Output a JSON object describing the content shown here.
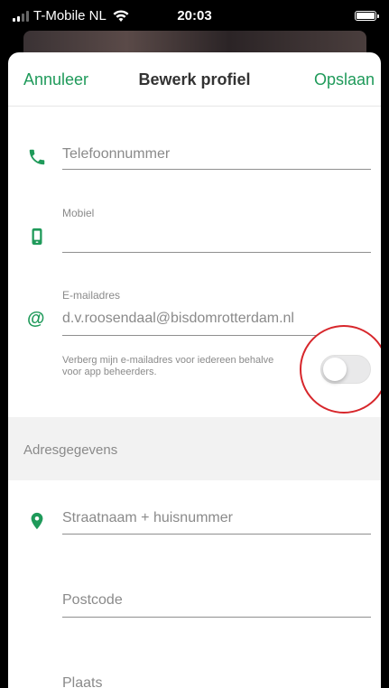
{
  "status_bar": {
    "carrier": "T-Mobile NL",
    "time": "20:03",
    "icons": [
      "signal-icon",
      "wifi-icon",
      "battery-icon"
    ]
  },
  "nav": {
    "cancel_label": "Annuleer",
    "title": "Bewerk profiel",
    "save_label": "Opslaan"
  },
  "fields": {
    "phone": {
      "placeholder": "Telefoonnummer",
      "icon": "phone-icon"
    },
    "mobile": {
      "label": "Mobiel",
      "value": "",
      "icon": "mobile-phone-icon"
    },
    "email": {
      "label": "E-mailadres",
      "value": "d.v.roosendaal@bisdomrotterdam.nl",
      "icon": "at-icon"
    },
    "hide_email": {
      "text": "Verberg mijn e-mailadres voor iedereen behalve voor app beheerders.",
      "toggle_on": false
    }
  },
  "address_section": {
    "title": "Adresgegevens",
    "street": {
      "placeholder": "Straatnaam + huisnummer",
      "icon": "map-pin-icon"
    },
    "postcode": {
      "placeholder": "Postcode"
    },
    "city": {
      "placeholder": "Plaats"
    }
  },
  "colors": {
    "accent": "#1f9a5a",
    "annotation": "#d7262b"
  }
}
